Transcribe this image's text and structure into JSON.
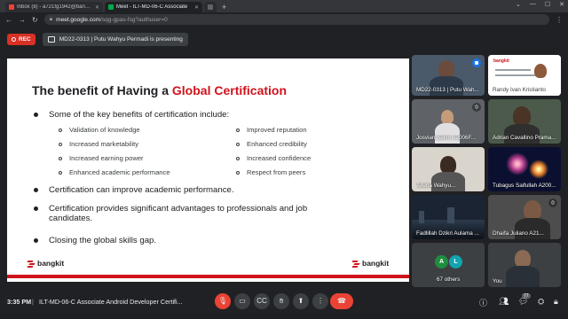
{
  "browser": {
    "tabs": [
      {
        "label": "Inbox (8) - a721fg1942@bangkit",
        "color": "#ea4335",
        "active": false
      },
      {
        "label": "Meet - ILT-MD-06-C Associate",
        "color": "#00ac47",
        "active": true
      },
      {
        "label": "",
        "color": "#5f6368",
        "active": false
      }
    ],
    "url_host": "meet.google.com",
    "url_path": "/sqg-gpas-fsg?authuser=0"
  },
  "meet": {
    "rec_label": "REC",
    "presenting_text": "MD22-0313 | Putu Wahyu Permadi is presenting"
  },
  "slide": {
    "title_plain": "The benefit of Having a ",
    "title_accent": "Global Certification",
    "bullet1": "Some of the key benefits of certification include:",
    "sub_left": [
      "Validation of knowledge",
      "Increased marketability",
      "Increased earning power",
      "Enhanced academic performance"
    ],
    "sub_right": [
      "Improved reputation",
      "Enhanced credibility",
      "Increased confidence",
      "Respect from peers"
    ],
    "bullet2": "Certification can improve academic performance.",
    "bullet3a": "Certification provides significant advantages to professionals and job",
    "bullet3b": "candidates.",
    "bullet4": "Closing the global skills gap.",
    "logo_text": "bangkit",
    "accent_color": "#d0121b"
  },
  "participants": [
    {
      "name": "MD22-0313 | Putu Wah...",
      "kind": "presenter"
    },
    {
      "name": "Randy Ivan Kristianto",
      "kind": "slide"
    },
    {
      "name": "Josvian Salim A2006F...",
      "kind": "person"
    },
    {
      "name": "Adrian Cavallino Prama...",
      "kind": "person"
    },
    {
      "name": "Alferia Wahyu...",
      "kind": "person"
    },
    {
      "name": "Tubagus Saifullah A200...",
      "kind": "fireworks"
    },
    {
      "name": "Fadlillah Dzikri Aulama ...",
      "kind": "city"
    },
    {
      "name": "Dhaifa Juliano A21...",
      "kind": "person"
    },
    {
      "name": "67 others",
      "kind": "others"
    },
    {
      "name": "You",
      "kind": "person"
    }
  ],
  "others_avatars": [
    "A",
    "L"
  ],
  "bottom": {
    "time": "3:35 PM",
    "separator": "|",
    "meeting_name": "ILT-MD-06-C Associate Android Developer Certifi...",
    "participant_count": "77"
  },
  "icons": {
    "mic": "mic-off-icon",
    "camera": "camera-icon",
    "captions": "captions-icon",
    "hand": "raise-hand-icon",
    "present": "present-icon",
    "more": "more-icon",
    "end": "end-call-icon"
  },
  "colors": {
    "end_call": "#ea4335",
    "rec": "#d93025",
    "presenter_badge": "#1a73e8"
  }
}
